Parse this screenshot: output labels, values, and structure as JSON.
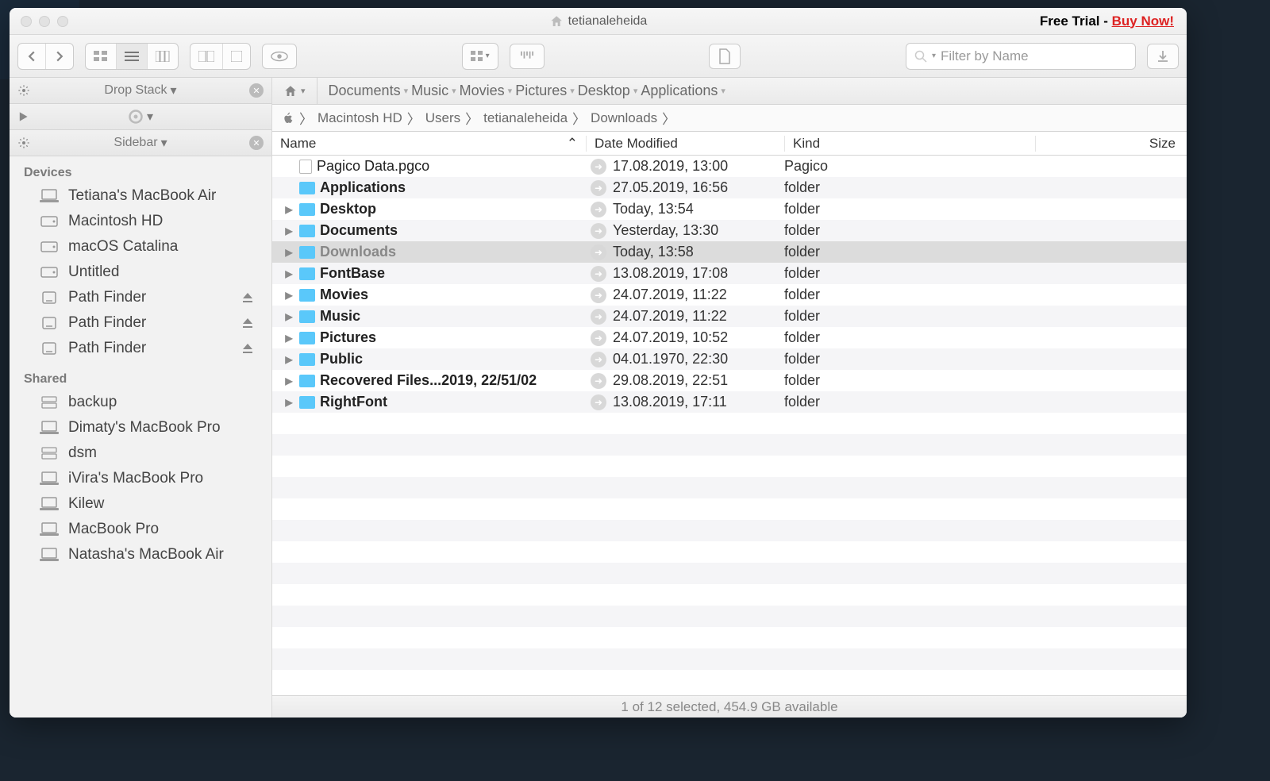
{
  "window": {
    "title": "tetianaleheida",
    "trial_prefix": "Free Trial - ",
    "trial_link": "Buy Now!"
  },
  "search": {
    "placeholder": "Filter by Name"
  },
  "sidebar_headers": {
    "dropstack": "Drop Stack",
    "sidebar": "Sidebar"
  },
  "sections": {
    "devices": "Devices",
    "devices_items": [
      {
        "label": "Tetiana's MacBook Air",
        "type": "laptop"
      },
      {
        "label": "Macintosh HD",
        "type": "hd"
      },
      {
        "label": "macOS Catalina",
        "type": "hd"
      },
      {
        "label": "Untitled",
        "type": "hd"
      },
      {
        "label": "Path Finder",
        "type": "ext",
        "eject": true
      },
      {
        "label": "Path Finder",
        "type": "ext",
        "eject": true
      },
      {
        "label": "Path Finder",
        "type": "ext",
        "eject": true
      }
    ],
    "shared": "Shared",
    "shared_items": [
      {
        "label": "backup",
        "type": "server"
      },
      {
        "label": "Dimaty's MacBook Pro",
        "type": "laptop"
      },
      {
        "label": "dsm",
        "type": "server"
      },
      {
        "label": "iVira's MacBook Pro",
        "type": "laptop"
      },
      {
        "label": "Kilew",
        "type": "laptop"
      },
      {
        "label": "MacBook Pro",
        "type": "laptop"
      },
      {
        "label": "Natasha's MacBook Air",
        "type": "laptop"
      }
    ]
  },
  "pathbar": [
    "Documents",
    "Music",
    "Movies",
    "Pictures",
    "Desktop",
    "Applications"
  ],
  "breadcrumb": [
    "Macintosh HD",
    "Users",
    "tetianaleheida",
    "Downloads"
  ],
  "columns": {
    "name": "Name",
    "date": "Date Modified",
    "kind": "Kind",
    "size": "Size"
  },
  "rows": [
    {
      "name": "Pagico Data.pgco",
      "date": "17.08.2019, 13:00",
      "kind": "Pagico",
      "expandable": false,
      "file": true,
      "bold": false,
      "selected": false
    },
    {
      "name": "Applications",
      "date": "27.05.2019, 16:56",
      "kind": "folder",
      "expandable": false,
      "file": false,
      "bold": true,
      "selected": false
    },
    {
      "name": "Desktop",
      "date": "Today, 13:54",
      "kind": "folder",
      "expandable": true,
      "file": false,
      "bold": true,
      "selected": false
    },
    {
      "name": "Documents",
      "date": "Yesterday, 13:30",
      "kind": "folder",
      "expandable": true,
      "file": false,
      "bold": true,
      "selected": false
    },
    {
      "name": "Downloads",
      "date": "Today, 13:58",
      "kind": "folder",
      "expandable": true,
      "file": false,
      "bold": true,
      "selected": true
    },
    {
      "name": "FontBase",
      "date": "13.08.2019, 17:08",
      "kind": "folder",
      "expandable": true,
      "file": false,
      "bold": true,
      "selected": false
    },
    {
      "name": "Movies",
      "date": "24.07.2019, 11:22",
      "kind": "folder",
      "expandable": true,
      "file": false,
      "bold": true,
      "selected": false
    },
    {
      "name": "Music",
      "date": "24.07.2019, 11:22",
      "kind": "folder",
      "expandable": true,
      "file": false,
      "bold": true,
      "selected": false
    },
    {
      "name": "Pictures",
      "date": "24.07.2019, 10:52",
      "kind": "folder",
      "expandable": true,
      "file": false,
      "bold": true,
      "selected": false
    },
    {
      "name": "Public",
      "date": "04.01.1970, 22:30",
      "kind": "folder",
      "expandable": true,
      "file": false,
      "bold": true,
      "selected": false
    },
    {
      "name": "Recovered Files...2019, 22/51/02",
      "date": "29.08.2019, 22:51",
      "kind": "folder",
      "expandable": true,
      "file": false,
      "bold": true,
      "selected": false
    },
    {
      "name": "RightFont",
      "date": "13.08.2019, 17:11",
      "kind": "folder",
      "expandable": true,
      "file": false,
      "bold": true,
      "selected": false
    }
  ],
  "status": "1 of 12 selected, 454.9 GB available"
}
